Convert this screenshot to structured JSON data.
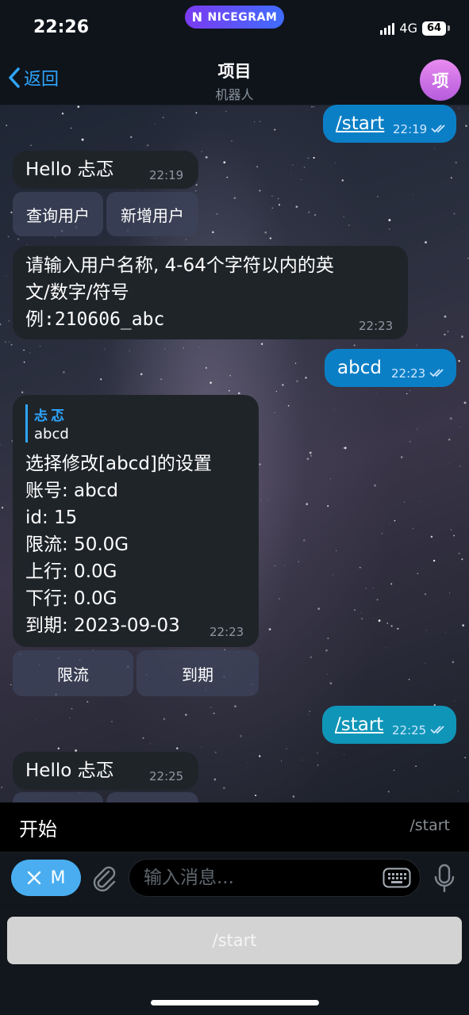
{
  "status": {
    "time": "22:26",
    "app_badge": "NICEGRAM",
    "network": "4G",
    "battery": "64"
  },
  "nav": {
    "back_label": "返回",
    "title": "项目",
    "subtitle": "机器人",
    "avatar_letter": "项"
  },
  "messages": {
    "m1": {
      "text": "/start",
      "time": "22:19"
    },
    "m2": {
      "text": "Hello 忐忑",
      "time": "22:19",
      "buttons": [
        "查询用户",
        "新增用户"
      ]
    },
    "m3": {
      "line1": "请输入用户名称, 4-64个字符以内的英",
      "line2": "文/数字/符号",
      "line3": "例:210606_abc",
      "time": "22:23"
    },
    "m4": {
      "text": "abcd",
      "time": "22:23"
    },
    "m5": {
      "quote_name": "忐忑",
      "quote_text": "abcd",
      "lines": [
        "选择修改[abcd]的设置",
        "账号: abcd",
        "id: 15",
        "限流: 50.0G",
        "上行: 0.0G",
        "下行: 0.0G",
        "到期: 2023-09-03"
      ],
      "time": "22:23",
      "buttons": [
        "限流",
        "到期"
      ]
    },
    "m6": {
      "text": "/start",
      "time": "22:25"
    },
    "m7": {
      "text": "Hello 忐忑",
      "time": "22:25"
    }
  },
  "command_suggestion": {
    "description": "开始",
    "command": "/start"
  },
  "input": {
    "menu_label": "M",
    "placeholder": "输入消息..."
  },
  "reply_keyboard": {
    "button": "/start"
  },
  "colors": {
    "accent": "#2ea6ff",
    "outgoing": "#0b7fc6",
    "incoming": "#1f2429",
    "menu": "#49adf0"
  }
}
